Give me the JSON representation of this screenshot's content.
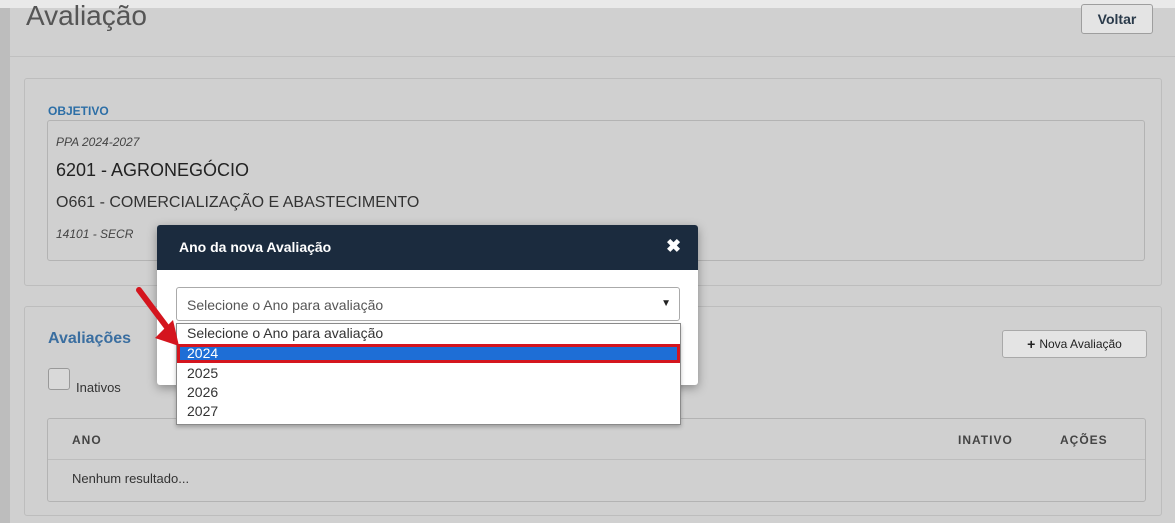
{
  "page": {
    "title": "Avaliação",
    "back_label": "Voltar"
  },
  "objetivo": {
    "section_label": "OBJETIVO",
    "ppa": "PPA 2024-2027",
    "program": "6201 - AGRONEGÓCIO",
    "objective": "O661 - COMERCIALIZAÇÃO E ABASTECIMENTO",
    "organ": "14101 - SECR"
  },
  "avaliacoes": {
    "title": "Avaliações",
    "new_button_label": "Nova Avaliação",
    "inativos_label": "Inativos",
    "table": {
      "columns": [
        "ANO",
        "INATIVO",
        "AÇÕES"
      ],
      "empty_text": "Nenhum resultado..."
    }
  },
  "modal": {
    "title": "Ano da nova Avaliação",
    "close_icon": "close-icon",
    "select": {
      "placeholder": "Selecione o Ano para avaliação",
      "options": [
        "Selecione o Ano para avaliação",
        "2024",
        "2025",
        "2026",
        "2027"
      ],
      "highlighted": "2024"
    }
  },
  "colors": {
    "modal_header": "#1b2b3e",
    "accent_blue": "#2c6ea6",
    "highlight": "#1e6ed6",
    "annotation_red": "#d4151e"
  }
}
